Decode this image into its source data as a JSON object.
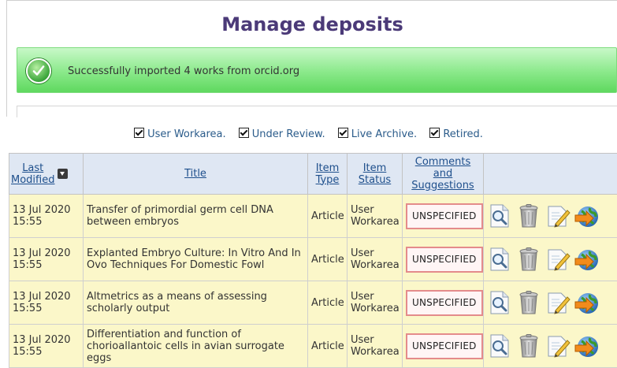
{
  "page_title": "Manage deposits",
  "message": {
    "text": "Successfully imported 4 works from orcid.org",
    "icon": "check-circle-icon"
  },
  "filters": [
    {
      "label": "User Workarea.",
      "checked": true
    },
    {
      "label": "Under Review.",
      "checked": true
    },
    {
      "label": "Live Archive.",
      "checked": true
    },
    {
      "label": "Retired.",
      "checked": true
    }
  ],
  "table": {
    "headers": {
      "last_modified_1": "Last",
      "last_modified_2": "Modified",
      "title": "Title",
      "item_type_1": "Item",
      "item_type_2": "Type",
      "item_status_1": "Item",
      "item_status_2": "Status",
      "comments_1": "Comments and",
      "comments_2": "Suggestions"
    },
    "rows": [
      {
        "date": "13 Jul 2020",
        "time": "15:55",
        "title": "Transfer of primordial germ cell DNA between embryos",
        "type": "Article",
        "status_1": "User",
        "status_2": "Workarea",
        "comments": "UNSPECIFIED"
      },
      {
        "date": "13 Jul 2020",
        "time": "15:55",
        "title": "Explanted Embryo Culture: In Vitro And In Ovo Techniques For Domestic Fowl",
        "type": "Article",
        "status_1": "User",
        "status_2": "Workarea",
        "comments": "UNSPECIFIED"
      },
      {
        "date": "13 Jul 2020",
        "time": "15:55",
        "title": "Altmetrics as a means of assessing scholarly output",
        "type": "Article",
        "status_1": "User",
        "status_2": "Workarea",
        "comments": "UNSPECIFIED"
      },
      {
        "date": "13 Jul 2020",
        "time": "15:55",
        "title": "Differentiation and function of chorioallantoic cells in avian surrogate eggs",
        "type": "Article",
        "status_1": "User",
        "status_2": "Workarea",
        "comments": "UNSPECIFIED"
      }
    ],
    "row_actions": [
      "view-icon",
      "trash-icon",
      "edit-icon",
      "deposit-globe-icon"
    ]
  },
  "colors": {
    "title": "#4b3a78",
    "success_bg": "#8ae98a",
    "header_bg": "#dfe7f3",
    "row_bg": "#fbf7c9",
    "badge_border": "#e48b8b",
    "link": "#1e4f8c"
  }
}
